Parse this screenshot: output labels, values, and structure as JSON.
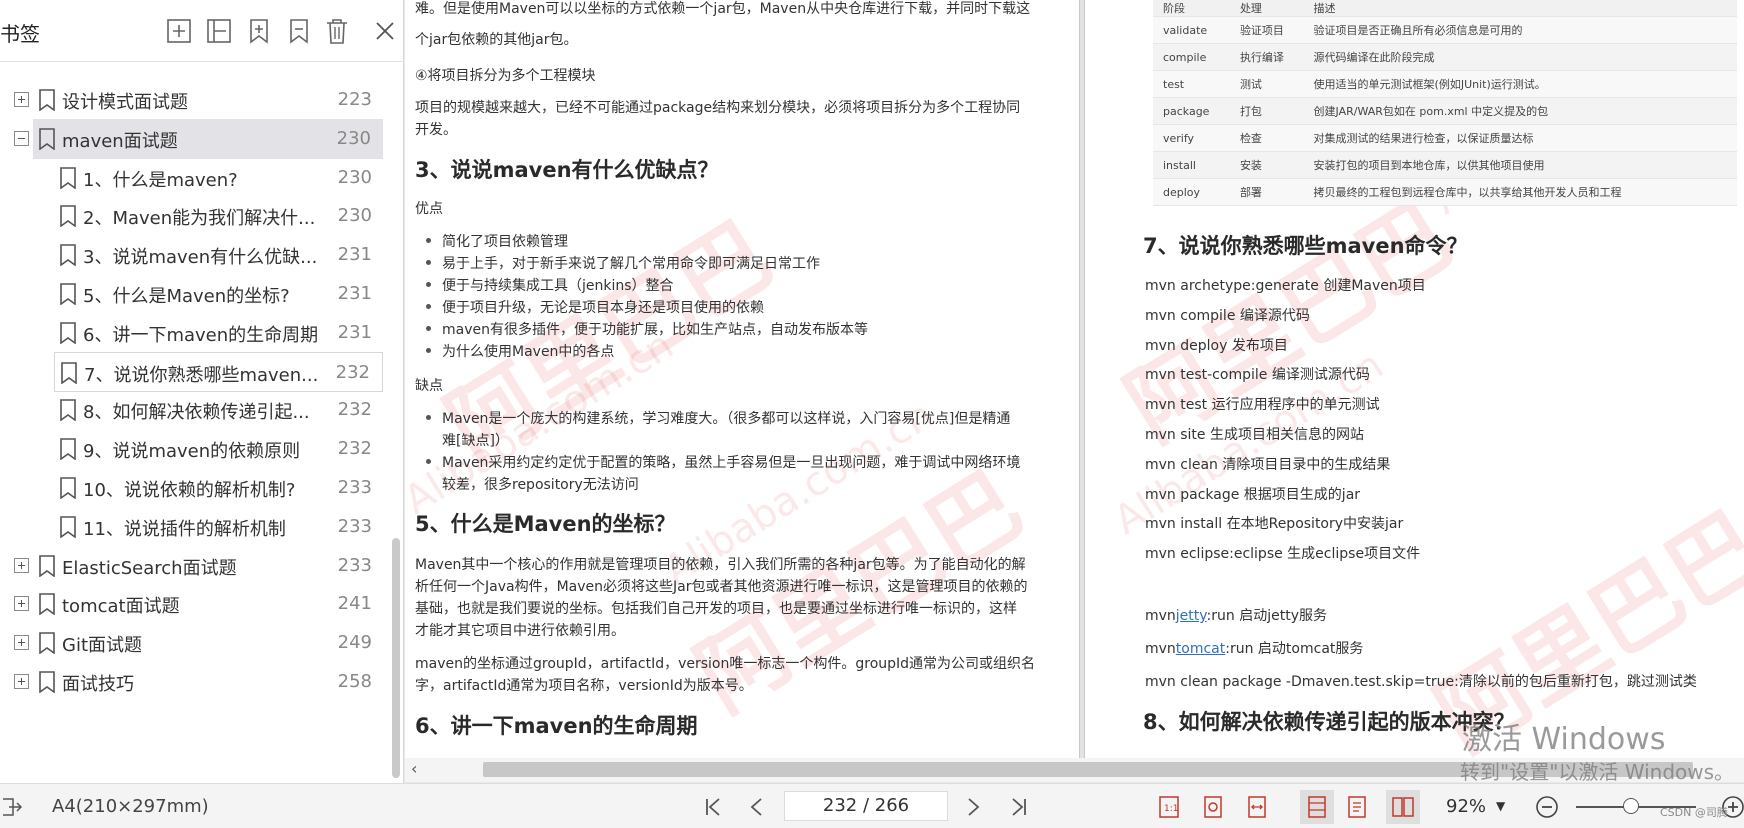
{
  "sidebar": {
    "title": "书签",
    "tools": [
      "add-bookmark-icon",
      "remove-bookmark-icon",
      "bookmark-add-child-icon",
      "bookmark-collapse-icon",
      "delete-icon",
      "close-icon"
    ],
    "items": [
      {
        "label": "设计模式面试题",
        "page": "223",
        "level": 0,
        "expander": "plus"
      },
      {
        "label": "maven面试题",
        "page": "230",
        "level": 0,
        "expander": "minus",
        "selected": true
      },
      {
        "label": "1、什么是maven?",
        "page": "230",
        "level": 1
      },
      {
        "label": "2、Maven能为我们解决什...",
        "page": "230",
        "level": 1
      },
      {
        "label": "3、说说maven有什么优缺...",
        "page": "231",
        "level": 1
      },
      {
        "label": "5、什么是Maven的坐标?",
        "page": "231",
        "level": 1
      },
      {
        "label": "6、讲一下maven的生命周期",
        "page": "231",
        "level": 1
      },
      {
        "label": "7、说说你熟悉哪些maven...",
        "page": "232",
        "level": 1,
        "hover": true
      },
      {
        "label": "8、如何解决依赖传递引起...",
        "page": "232",
        "level": 1
      },
      {
        "label": "9、说说maven的依赖原则",
        "page": "232",
        "level": 1
      },
      {
        "label": "10、说说依赖的解析机制?",
        "page": "233",
        "level": 1
      },
      {
        "label": "11、说说插件的解析机制",
        "page": "233",
        "level": 1
      },
      {
        "label": "ElasticSearch面试题",
        "page": "233",
        "level": 0,
        "expander": "plus"
      },
      {
        "label": "tomcat面试题",
        "page": "241",
        "level": 0,
        "expander": "plus"
      },
      {
        "label": "Git面试题",
        "page": "249",
        "level": 0,
        "expander": "plus"
      },
      {
        "label": "面试技巧",
        "page": "258",
        "level": 0,
        "expander": "plus"
      }
    ]
  },
  "left_page": {
    "top_line1": "难。但是使用Maven可以以坐标的方式依赖一个jar包，Maven从中央仓库进行下载，并同时下载这",
    "top_line2": "个jar包依赖的其他jar包。",
    "item4": "④将项目拆分为多个工程模块",
    "item4_p1": "项目的规模越来越大，已经不可能通过package结构来划分模块，必须将项目拆分为多个工程协同",
    "item4_p2": "开发。",
    "h3_q3": "3、说说maven有什么优缺点？",
    "adv_title": "优点",
    "adv": [
      "简化了项目依赖管理",
      "易于上手，对于新手来说了解几个常用命令即可满足日常工作",
      "便于与持续集成工具（jenkins）整合",
      "便于项目升级，无论是项目本身还是项目使用的依赖",
      "maven有很多插件，便于功能扩展，比如生产站点，自动发布版本等",
      "为什么使用Maven中的各点"
    ],
    "dis_title": "缺点",
    "dis1_l1": "Maven是一个庞大的构建系统，学习难度大。（很多都可以这样说，入门容易[优点]但是精通",
    "dis1_l2": "难[缺点]）",
    "dis2_l1": "Maven采用约定约定优于配置的策略，虽然上手容易但是一旦出现问题，难于调试中网络环境",
    "dis2_l2": "较差，很多repository无法访问",
    "h3_q5": "5、什么是Maven的坐标？",
    "q5_p1_l1": "Maven其中一个核心的作用就是管理项目的依赖，引入我们所需的各种jar包等。为了能自动化的解",
    "q5_p1_l2": "析任何一个Java构件，Maven必须将这些Jar包或者其他资源进行唯一标识，这是管理项目的依赖的",
    "q5_p1_l3": "基础，也就是我们要说的坐标。包括我们自己开发的项目，也是要通过坐标进行唯一标识的，这样",
    "q5_p1_l4": "才能才其它项目中进行依赖引用。",
    "q5_p2_l1": "maven的坐标通过groupId，artifactId，version唯一标志一个构件。groupId通常为公司或组织名",
    "q5_p2_l2": "字，artifactId通常为项目名称，versionId为版本号。",
    "h3_q6": "6、讲一下maven的生命周期"
  },
  "right_page": {
    "table": {
      "headers": [
        "阶段",
        "处理",
        "描述"
      ],
      "rows": [
        [
          "validate",
          "验证项目",
          "验证项目是否正确且所有必须信息是可用的"
        ],
        [
          "compile",
          "执行编译",
          "源代码编译在此阶段完成"
        ],
        [
          "test",
          "测试",
          "使用适当的单元测试框架(例如JUnit)运行测试。"
        ],
        [
          "package",
          "打包",
          "创建JAR/WAR包如在 pom.xml 中定义提及的包"
        ],
        [
          "verify",
          "检查",
          "对集成测试的结果进行检查，以保证质量达标"
        ],
        [
          "install",
          "安装",
          "安装打包的项目到本地仓库，以供其他项目使用"
        ],
        [
          "deploy",
          "部署",
          "拷贝最终的工程包到远程仓库中，以共享给其他开发人员和工程"
        ]
      ]
    },
    "h3_q7": "7、说说你熟悉哪些maven命令？",
    "cmds": [
      "mvn archetype:generate 创建Maven项目",
      "mvn compile 编译源代码",
      "mvn deploy 发布项目",
      "mvn test-compile 编译测试源代码",
      "mvn test 运行应用程序中的单元测试",
      "mvn site 生成项目相关信息的网站",
      "mvn clean 清除项目目录中的生成结果",
      "mvn package 根据项目生成的jar",
      "mvn install 在本地Repository中安装jar",
      "mvn eclipse:eclipse 生成eclipse项目文件"
    ],
    "cmd_jetty_pre": "mvn",
    "cmd_jetty_link": "jetty",
    "cmd_jetty_post": ":run 启动jetty服务",
    "cmd_tomcat_pre": "mvn",
    "cmd_tomcat_link": "tomcat",
    "cmd_tomcat_post": ":run 启动tomcat服务",
    "cmd_last": "mvn clean package -Dmaven.test.skip=true:清除以前的包后重新打包，跳过测试类",
    "h3_q8": "8、如何解决依赖传递引起的版本冲突？"
  },
  "watermark": {
    "cn": "阿里巴巴",
    "en": "Alibaba.com.cn"
  },
  "activation": {
    "line1": "激活 Windows",
    "line2": "转到\"设置\"以激活 Windows。"
  },
  "status": {
    "page_size": "A4(210×297mm)",
    "page_indicator": "232 / 266",
    "zoom": "92%",
    "zoom_level": 0.46,
    "credit": "CSDN @司腾"
  }
}
